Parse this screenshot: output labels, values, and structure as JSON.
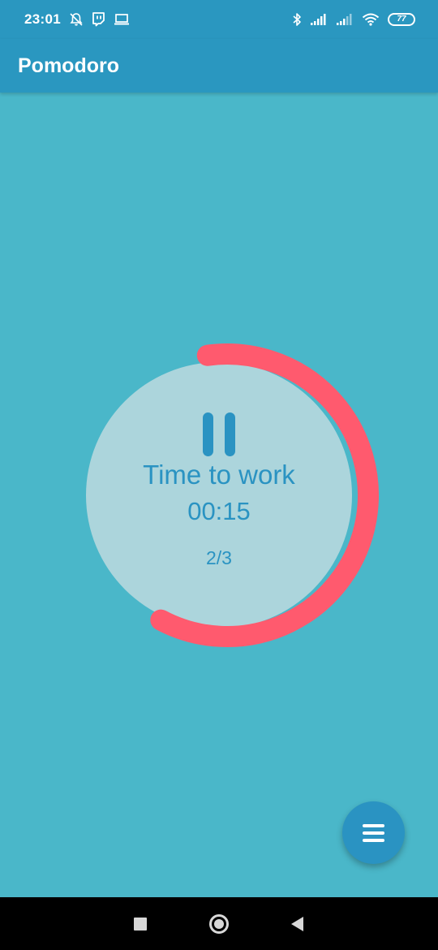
{
  "status_bar": {
    "time": "23:01",
    "left_icons": [
      "notifications-off-icon",
      "twitch-icon",
      "laptop-icon"
    ],
    "right_icons": [
      "bluetooth-icon",
      "signal-icon",
      "signal-icon",
      "wifi-icon",
      "battery-icon"
    ],
    "battery_level": "77"
  },
  "app_bar": {
    "title": "Pomodoro"
  },
  "timer": {
    "state_icon": "pause-icon",
    "label": "Time to work",
    "time": "00:15",
    "round": "2/3",
    "progress_fraction": 0.6
  },
  "fab": {
    "icon": "menu-icon"
  },
  "nav_bar": {
    "buttons": [
      "recents-icon",
      "home-icon",
      "back-icon"
    ]
  },
  "colors": {
    "background": "#4ab7c9",
    "primary": "#2a97c0",
    "accent_ring": "#ff5a6e",
    "inner_circle": "#acd5dc",
    "text_blue": "#2a93c2"
  }
}
